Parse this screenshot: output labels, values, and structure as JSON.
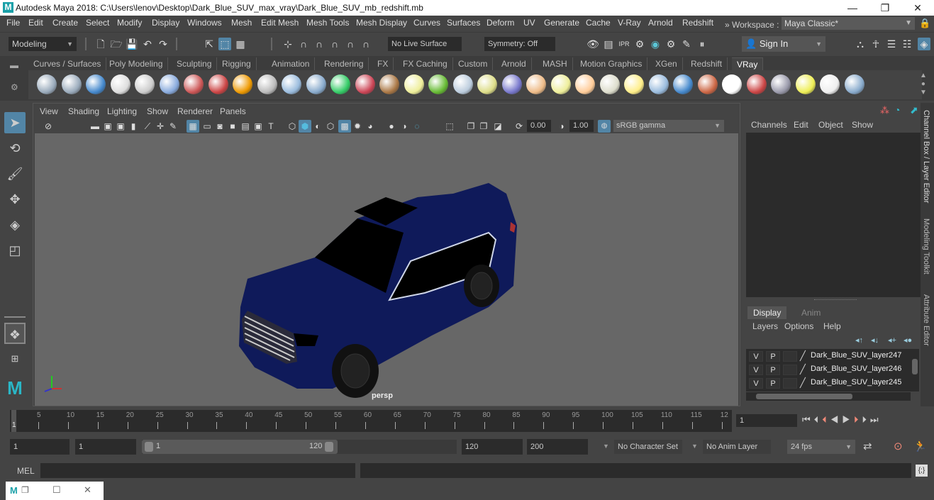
{
  "window": {
    "title": "Autodesk Maya 2018: C:\\Users\\lenov\\Desktop\\Dark_Blue_SUV_max_vray\\Dark_Blue_SUV_mb_redshift.mb",
    "app_icon": "maya-logo-icon",
    "controls": {
      "minimize": "—",
      "restore": "❐",
      "close": "✕"
    }
  },
  "menubar": {
    "items": [
      "File",
      "Edit",
      "Create",
      "Select",
      "Modify",
      "Display",
      "Windows",
      "Mesh",
      "Edit Mesh",
      "Mesh Tools",
      "Mesh Display",
      "Curves",
      "Surfaces",
      "Deform",
      "UV",
      "Generate",
      "Cache",
      "V-Ray",
      "Arnold",
      "Redshift"
    ],
    "workspace_label": "» Workspace :",
    "workspace_value": "Maya Classic*"
  },
  "statusline": {
    "menuset": "Modeling",
    "live_surface": "No Live Surface",
    "symmetry": "Symmetry: Off",
    "sign_in": "Sign In"
  },
  "shelf": {
    "tabs": [
      "Curves / Surfaces",
      "Poly Modeling",
      "Sculpting",
      "Rigging",
      "Animation",
      "Rendering",
      "FX",
      "FX Caching",
      "Custom",
      "Arnold",
      "MASH",
      "Motion Graphics",
      "XGen",
      "Redshift",
      "VRay"
    ],
    "active_tab": "VRay",
    "icons": [
      "vray-save-icon",
      "vray-folder-icon",
      "vray-list-icon",
      "vray-logo-icon",
      "vray-doc-icon",
      "vray-sphere-stand-icon",
      "vray-camera-icon",
      "vray-spheres-icon",
      "vray-fire-icon",
      "vray-mesh-icon",
      "vray-cube-icon",
      "vray-shapes-icon",
      "vray-light-icon",
      "vray-globe-icon",
      "vray-texture-icon",
      "vray-sun-sphere-icon",
      "vray-grass-icon",
      "vray-gear-icon",
      "vray-curve-icon",
      "vray-ball-icon",
      "vray-dome-icon",
      "vray-spot-icon",
      "vray-sphere-light-icon",
      "vray-ies-icon",
      "vray-sun-icon",
      "vray-plane-icon",
      "vray-blue-sphere-icon",
      "vray-striped-sphere-icon",
      "vray-checker-icon",
      "vray-frame-buffer-icon",
      "vray-settings-icon",
      "vray-lightbulb-icon",
      "vray-cloud-icon",
      "vray-help-icon"
    ]
  },
  "viewport": {
    "menu": [
      "View",
      "Shading",
      "Lighting",
      "Show",
      "Renderer",
      "Panels"
    ],
    "exposure": "0.00",
    "gamma": "1.00",
    "color_space": "sRGB gamma",
    "camera": "persp",
    "model_color": "#0f1a5a"
  },
  "channelbox": {
    "menu": [
      "Channels",
      "Edit",
      "Object",
      "Show"
    ]
  },
  "layer_editor": {
    "tabs": [
      "Display",
      "Anim"
    ],
    "active_tab": "Display",
    "menu": [
      "Layers",
      "Options",
      "Help"
    ],
    "layers": [
      {
        "v": "V",
        "p": "P",
        "name": "Dark_Blue_SUV_layer247"
      },
      {
        "v": "V",
        "p": "P",
        "name": "Dark_Blue_SUV_layer246"
      },
      {
        "v": "V",
        "p": "P",
        "name": "Dark_Blue_SUV_layer245"
      }
    ]
  },
  "side_tabs": [
    "Channel Box / Layer Editor",
    "Modeling Toolkit",
    "Attribute Editor"
  ],
  "timeline": {
    "ticks": [
      "5",
      "10",
      "15",
      "20",
      "25",
      "30",
      "35",
      "40",
      "45",
      "50",
      "55",
      "60",
      "65",
      "70",
      "75",
      "80",
      "85",
      "90",
      "95",
      "100",
      "105",
      "110",
      "115",
      "12"
    ],
    "current_frame_marker": "1",
    "current_frame": "1"
  },
  "range": {
    "start": "1",
    "playback_start": "1",
    "slider_start": "1",
    "slider_end": "120",
    "playback_end": "120",
    "end": "200",
    "character_set": "No Character Set",
    "anim_layer": "No Anim Layer",
    "fps": "24 fps"
  },
  "cmdline": {
    "label": "MEL"
  },
  "accent": "#5285a6"
}
